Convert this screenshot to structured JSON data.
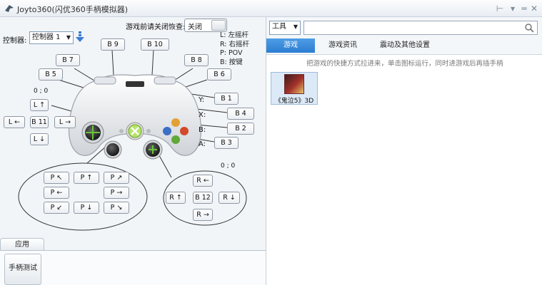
{
  "window": {
    "title": "Joyto360(闪优360手柄模拟器)",
    "controls": [
      "pin-icon",
      "minimize-icon",
      "dropdown-icon",
      "close-icon"
    ]
  },
  "left": {
    "game_close_label": "游戏前请关闭恢查:",
    "toggle_value": "关闭",
    "controller_label": "控制器:",
    "controller_value": "控制器 1",
    "legend": [
      "L:  左摇杆",
      "R:  右摇杆",
      "P:  POV",
      "B:  按键"
    ],
    "buttons": {
      "b9": "B 9",
      "b10": "B 10",
      "b7": "B 7",
      "b8": "B 8",
      "b5": "B 5",
      "b6": "B 6",
      "b1": "B 1",
      "b4": "B 4",
      "b2": "B 2",
      "b3": "B 3",
      "b11": "B 11",
      "b12": "B 12",
      "l_up": "L ↑",
      "l_left": "L ←",
      "l_right": "L →",
      "l_down": "L ↓",
      "r_up": "R ←",
      "r_left": "R ↑",
      "r_right": "R ↓",
      "r_down": "R →",
      "p_ul": "P ↖",
      "p_u": "P ↑",
      "p_ur": "P ↗",
      "p_l": "P ←",
      "p_r": "P →",
      "p_dl": "P ↙",
      "p_d": "P ↓",
      "p_dr": "P ↘"
    },
    "axis_labels": {
      "y": "Y:",
      "x": "X:",
      "b": "B:",
      "a": "A:"
    },
    "l_coord": "0 ; 0",
    "r_coord": "0 ; 0",
    "app_tab": "应用",
    "app_item": "手柄测试"
  },
  "right": {
    "tool_select": "工具",
    "search_value": "",
    "tabs": [
      "游戏",
      "游戏资讯",
      "震动及其他设置"
    ],
    "active_tab": 0,
    "hint": "把游戏的快捷方式拉进来，单击图标运行，同时进游戏后再插手柄",
    "game_name": "《鬼泣5》3D"
  },
  "colors": {
    "accent": "#2c7dd2"
  }
}
